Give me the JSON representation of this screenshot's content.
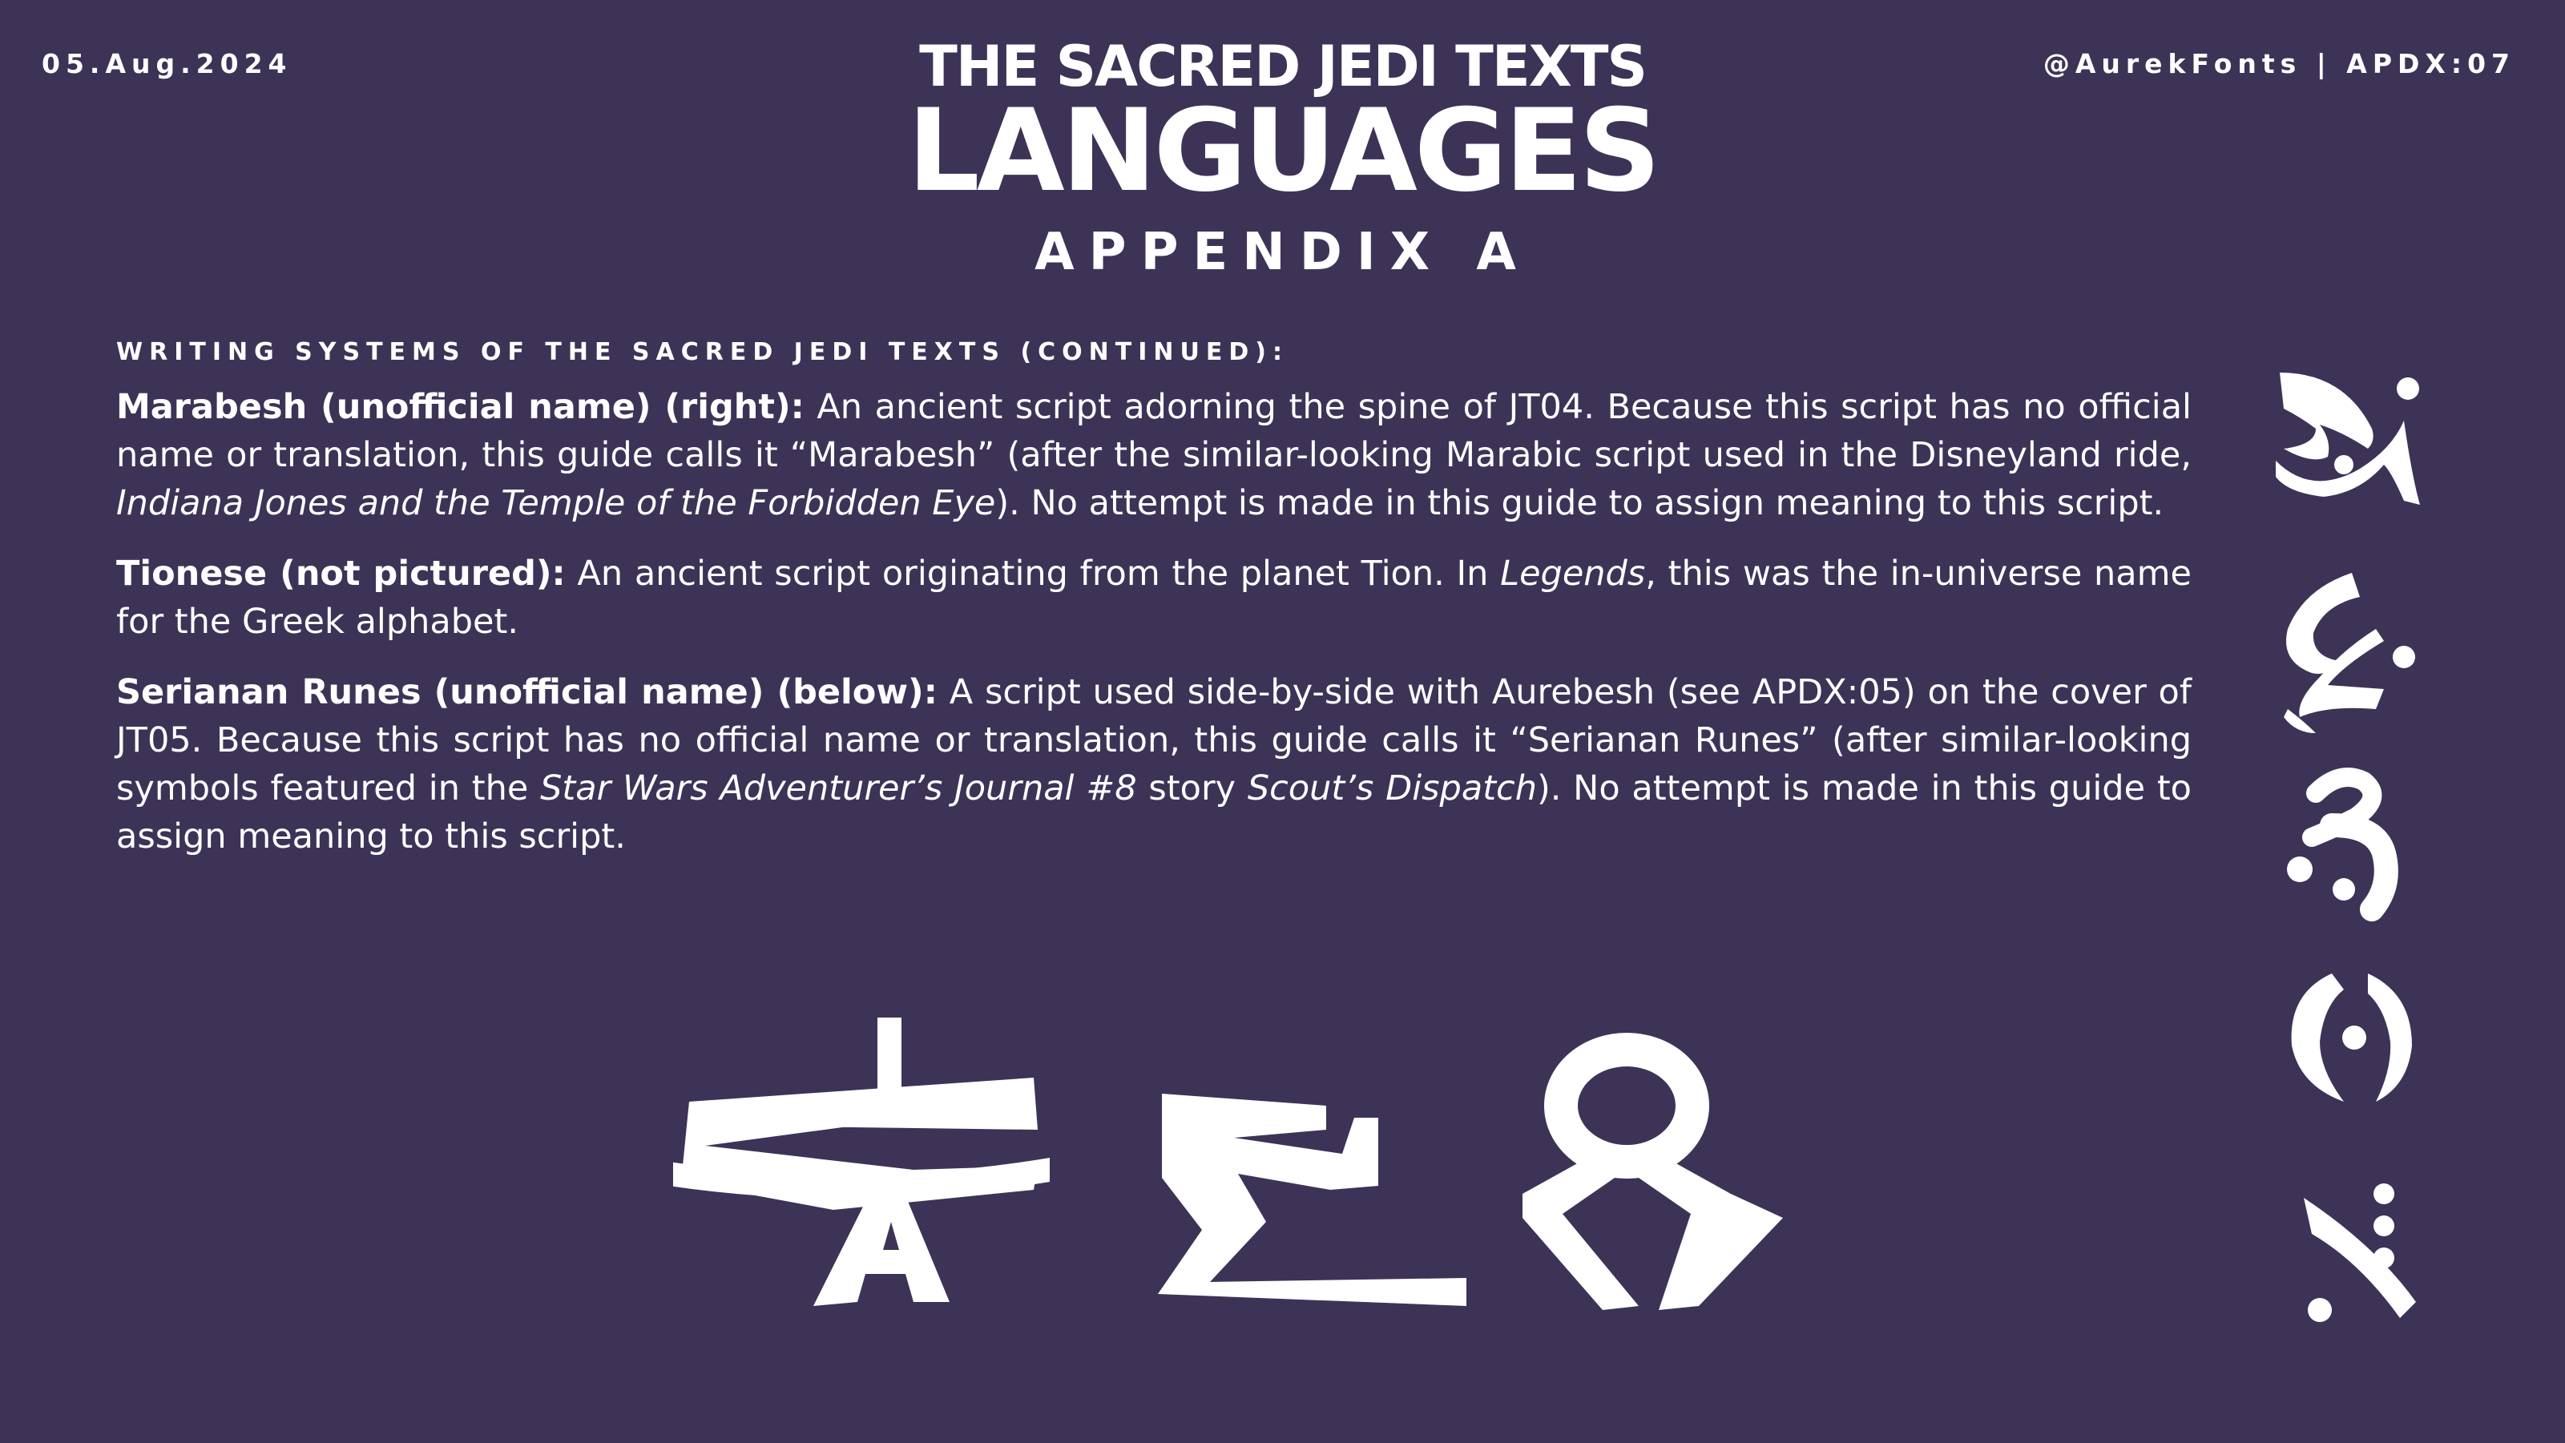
{
  "header": {
    "date": "05.Aug.2024",
    "credit": "@AurekFonts | APDX:07",
    "supertitle": "THE SACRED JEDI TEXTS",
    "title": "LANGUAGES",
    "subtitle": "APPENDIX A"
  },
  "section_heading": "WRITING SYSTEMS OF THE SACRED JEDI TEXTS (CONTINUED):",
  "paragraphs": [
    {
      "term": "Marabesh (unofficial name) (right):",
      "t1": " An ancient script adorning the spine of JT04. Because this script has no official name or translation, this guide calls it “Marabesh” (after the similar-looking Marabic script used in the Disneyland ride, ",
      "em1": "Indiana Jones and the Temple of the Forbidden Eye",
      "t2": "). No attempt is made in this guide to assign meaning to this script."
    },
    {
      "term": "Tionese (not pictured):",
      "t1": " An ancient script originating from the planet Tion. In ",
      "em1": "Legends",
      "t2": ", this was the in-universe name for the Greek alphabet."
    },
    {
      "term": "Serianan Runes (unofficial name) (below):",
      "t1": " A script used side-by-side with Aurebesh (see APDX:05) on the cover of JT05. Because this script has no official name or translation, this guide calls it “Serianan Runes” (after similar-looking symbols featured in the ",
      "em1": "Star Wars Adventurer’s Journal #8",
      "t2": " story ",
      "em2": "Scout’s Dispatch",
      "t3": "). No attempt is made in this guide to assign meaning to this script."
    }
  ],
  "figures": {
    "serianan_runes_icon": "serianan-rune-glyphs",
    "marabesh_icon": "marabesh-glyphs"
  },
  "colors": {
    "background": "#3d3357",
    "foreground": "#ffffff"
  }
}
